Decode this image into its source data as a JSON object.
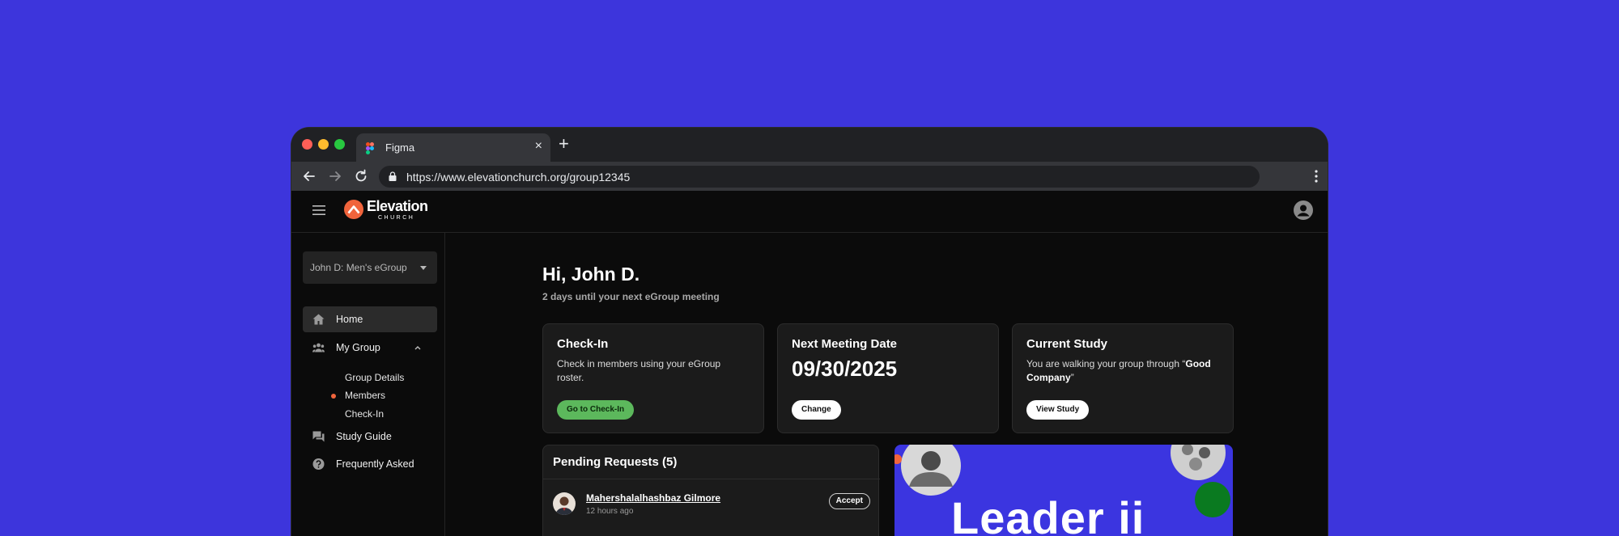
{
  "browser": {
    "tab_title": "Figma",
    "tab_close_glyph": "×",
    "new_tab_glyph": "+",
    "url": "https://www.elevationchurch.org/group12345"
  },
  "brand": {
    "name": "Elevation",
    "subtitle": "CHURCH",
    "accent": "#f0643c"
  },
  "sidebar": {
    "group_select": "John D: Men's eGroup",
    "items": [
      {
        "label": "Home",
        "icon": "home-icon",
        "active": true
      },
      {
        "label": "My Group",
        "icon": "group-icon",
        "expanded": true
      },
      {
        "label": "Study Guide",
        "icon": "chat-icon"
      },
      {
        "label": "Frequently Asked",
        "icon": "help-icon"
      }
    ],
    "sub_items": [
      {
        "label": "Group Details"
      },
      {
        "label": "Members",
        "marked": true
      },
      {
        "label": "Check-In"
      }
    ]
  },
  "main": {
    "greeting": "Hi, John D.",
    "subtitle": "2 days until your next eGroup meeting",
    "cards": {
      "checkin": {
        "title": "Check-In",
        "desc": "Check in members using your eGroup roster.",
        "button": "Go to Check-In"
      },
      "meeting": {
        "title": "Next Meeting Date",
        "date": "09/30/2025",
        "button": "Change"
      },
      "study": {
        "title": "Current Study",
        "desc_prefix": "You are walking your group through “",
        "desc_study": "Good Company",
        "desc_suffix": "”",
        "button": "View Study"
      }
    },
    "requests": {
      "title": "Pending Requests (5)",
      "items": [
        {
          "name": "Mahershalalhashbaz Gilmore",
          "time": "12 hours ago",
          "action": "Accept"
        }
      ]
    },
    "promo": {
      "text": "Leader  ii"
    }
  }
}
